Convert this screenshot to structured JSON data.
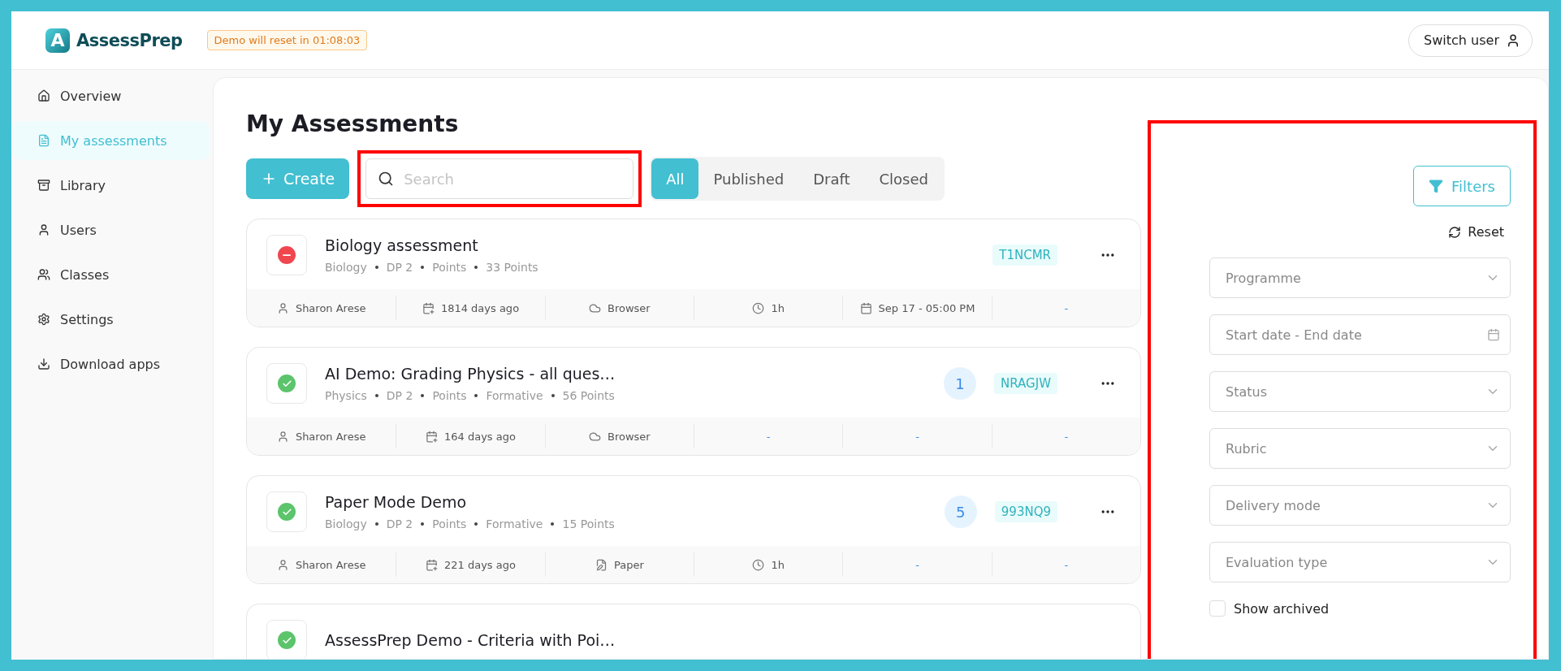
{
  "header": {
    "logo_letter": "A",
    "brand": "AssessPrep",
    "demo_notice": "Demo will reset in 01:08:03",
    "switch_user": "Switch user"
  },
  "sidebar": {
    "items": [
      {
        "label": "Overview",
        "selected": false
      },
      {
        "label": "My assessments",
        "selected": true
      },
      {
        "label": "Library",
        "selected": false
      },
      {
        "label": "Users",
        "selected": false
      },
      {
        "label": "Classes",
        "selected": false
      },
      {
        "label": "Settings",
        "selected": false
      },
      {
        "label": "Download apps",
        "selected": false
      }
    ]
  },
  "page": {
    "title": "My Assessments",
    "create_button": "Create",
    "search": {
      "placeholder": "Search"
    },
    "tabs": [
      {
        "label": "All",
        "selected": true
      },
      {
        "label": "Published",
        "selected": false
      },
      {
        "label": "Draft",
        "selected": false
      },
      {
        "label": "Closed",
        "selected": false
      }
    ]
  },
  "assessments": [
    {
      "title": "Biology assessment",
      "kind": "closed",
      "meta": [
        "Biology",
        "DP 2",
        "Points",
        "33 Points"
      ],
      "code": "T1NCMR",
      "details": [
        {
          "kind": "user",
          "text": "Sharon Arese"
        },
        {
          "kind": "created",
          "text": "1814 days ago"
        },
        {
          "kind": "browser",
          "text": "Browser"
        },
        {
          "kind": "duration",
          "text": "1h"
        },
        {
          "kind": "date",
          "text": "Sep 17 - 05:00 PM"
        },
        {
          "kind": "none",
          "text": "-"
        }
      ]
    },
    {
      "title": "AI Demo: Grading Physics - all ques…",
      "kind": "published",
      "meta": [
        "Physics",
        "DP 2",
        "Points",
        "Formative",
        "56 Points"
      ],
      "count": "1",
      "code": "NRAGJW",
      "details": [
        {
          "kind": "user",
          "text": "Sharon Arese"
        },
        {
          "kind": "created",
          "text": "164 days ago"
        },
        {
          "kind": "browser",
          "text": "Browser"
        },
        {
          "kind": "none",
          "text": "-"
        },
        {
          "kind": "none",
          "text": "-"
        },
        {
          "kind": "none",
          "text": "-"
        }
      ]
    },
    {
      "title": "Paper Mode Demo",
      "kind": "published",
      "meta": [
        "Biology",
        "DP 2",
        "Points",
        "Formative",
        "15 Points"
      ],
      "count": "5",
      "code": "993NQ9",
      "details": [
        {
          "kind": "user",
          "text": "Sharon Arese"
        },
        {
          "kind": "created",
          "text": "221 days ago"
        },
        {
          "kind": "paper",
          "text": "Paper"
        },
        {
          "kind": "duration",
          "text": "1h"
        },
        {
          "kind": "none",
          "text": "-"
        },
        {
          "kind": "none",
          "text": "-"
        }
      ]
    },
    {
      "title": "AssessPrep Demo - Criteria with Poi…",
      "kind": "published"
    }
  ],
  "filters": {
    "button": "Filters",
    "reset": "Reset",
    "fields": [
      {
        "kind": "select",
        "placeholder": "Programme"
      },
      {
        "kind": "date",
        "placeholder": "Start date - End date"
      },
      {
        "kind": "select",
        "placeholder": "Status"
      },
      {
        "kind": "select",
        "placeholder": "Rubric"
      },
      {
        "kind": "select",
        "placeholder": "Delivery mode"
      },
      {
        "kind": "select",
        "placeholder": "Evaluation type"
      }
    ],
    "show_archived": {
      "label": "Show archived",
      "checked": false
    }
  }
}
